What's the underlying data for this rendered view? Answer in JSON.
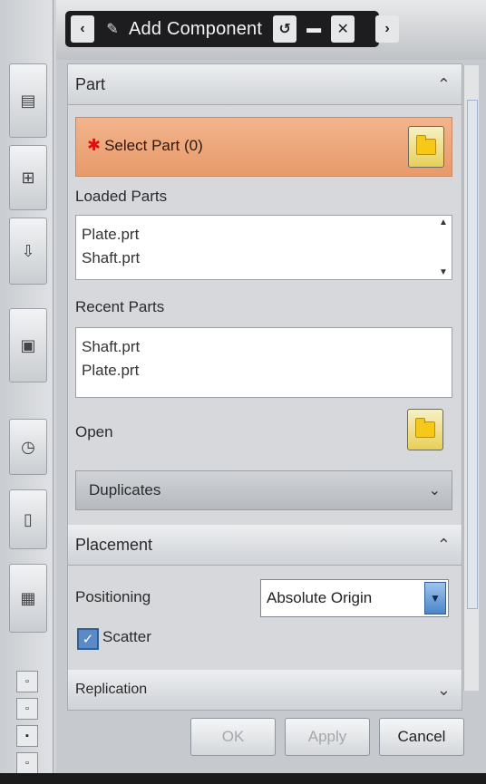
{
  "dialog": {
    "title": "Add Component",
    "part_section": {
      "title": "Part",
      "select_part_label": "Select Part (0)",
      "loaded_parts_label": "Loaded Parts",
      "loaded_parts": [
        "Plate.prt",
        "Shaft.prt"
      ],
      "recent_parts_label": "Recent Parts",
      "recent_parts": [
        "Shaft.prt",
        "Plate.prt"
      ],
      "open_label": "Open",
      "duplicates_label": "Duplicates"
    },
    "placement_section": {
      "title": "Placement",
      "positioning_label": "Positioning",
      "positioning_value": "Absolute Origin",
      "scatter_label": "Scatter",
      "scatter_checked": true
    },
    "replication_label": "Replication",
    "buttons": {
      "ok": "OK",
      "apply": "Apply",
      "cancel": "Cancel"
    }
  },
  "colors": {
    "selection_highlight": "#e79a6b",
    "title_bar": "#1d1d1f",
    "accent_blue": "#4a86c8"
  }
}
